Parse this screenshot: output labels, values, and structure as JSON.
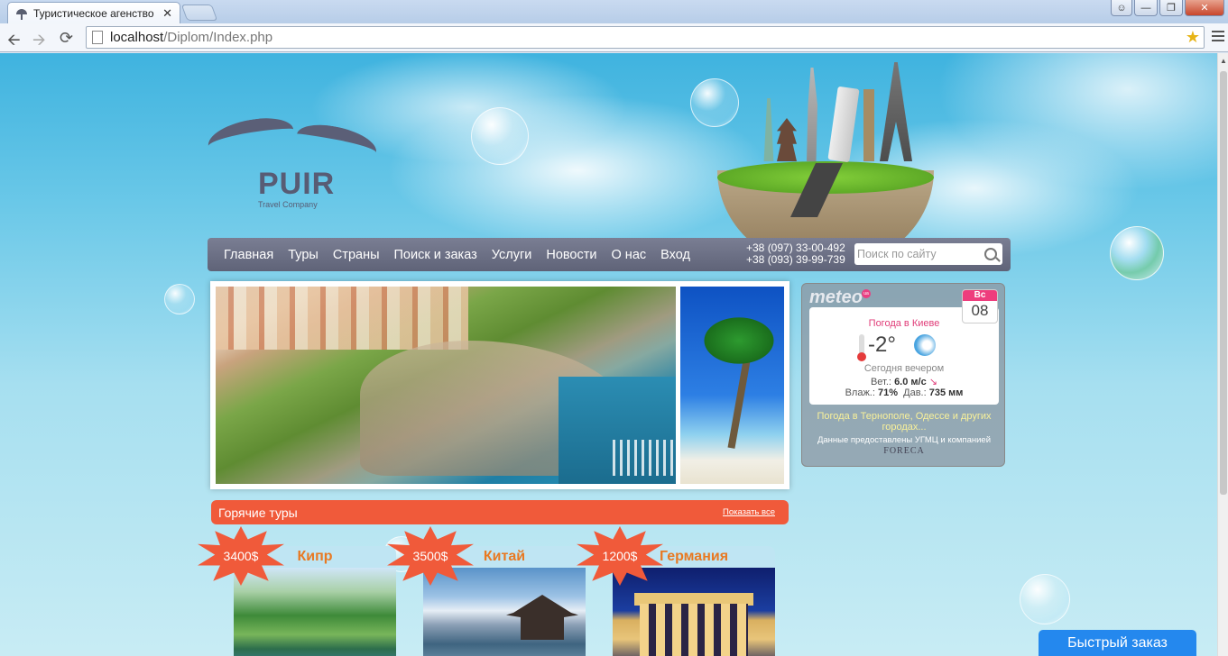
{
  "browser": {
    "tab_title": "Туристическое агенство",
    "tab_close": "✕",
    "url_host": "localhost",
    "url_path": "/Diplom/Index.php",
    "window_buttons": {
      "minimize": "—",
      "maximize": "❐",
      "close": "✕"
    }
  },
  "logo": {
    "name": "PUIR",
    "tagline": "Travel Company"
  },
  "nav": {
    "items": [
      "Главная",
      "Туры",
      "Страны",
      "Поиск и заказ",
      "Услуги",
      "Новости",
      "О нас",
      "Вход"
    ],
    "phones": [
      "+38 (097) 33-00-492",
      "+38 (093) 39-99-739"
    ],
    "search_placeholder": "Поиск по сайту"
  },
  "weather": {
    "brand": "meteo",
    "brand_badge": "ua",
    "city": "Погода в Киеве",
    "temperature": "-2°",
    "period": "Сегодня вечером",
    "wind_label": "Вет.:",
    "wind_value": "6.0 м/с",
    "humidity_label": "Влаж.:",
    "humidity_value": "71%",
    "pressure_label": "Дав.:",
    "pressure_value": "735 мм",
    "day_of_week": "Вс",
    "day": "08",
    "other_cities_link": "Погода в Тернополе, Одессе и других городах...",
    "credit": "Данные предоставлены УГМЦ и компанией",
    "foreca": "FORECA"
  },
  "hot_tours": {
    "title": "Горячие туры",
    "show_all": "Показать все",
    "tours": [
      {
        "name": "Кипр",
        "price": "3400$"
      },
      {
        "name": "Китай",
        "price": "3500$"
      },
      {
        "name": "Германия",
        "price": "1200$"
      }
    ]
  },
  "quick_order": "Быстрый заказ"
}
